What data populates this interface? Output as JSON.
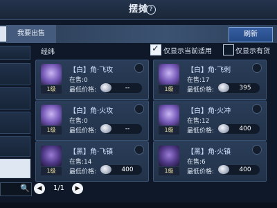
{
  "header": {
    "title": "摆摊",
    "help_icon_text": "?"
  },
  "tabs": [
    {
      "label": "我要出售"
    }
  ],
  "toolbar": {
    "refresh_label": "刷新"
  },
  "section": {
    "heading": "经纬"
  },
  "filters": {
    "current_use": {
      "label": "仅显示当前适用",
      "checked": true
    },
    "in_stock": {
      "label": "仅显示有货",
      "checked": false
    }
  },
  "items": [
    {
      "name": "【白】角·飞攻",
      "stock": "在售:0",
      "min_price_label": "最低价格:",
      "price": "--",
      "level": "1级",
      "quality": "white"
    },
    {
      "name": "【白】角·飞刺",
      "stock": "在售:17",
      "min_price_label": "最低价格:",
      "price": "395",
      "level": "1级",
      "quality": "white"
    },
    {
      "name": "【白】角·火攻",
      "stock": "在售:0",
      "min_price_label": "最低价格:",
      "price": "--",
      "level": "1级",
      "quality": "white"
    },
    {
      "name": "【白】角·火冲",
      "stock": "在售:12",
      "min_price_label": "最低价格:",
      "price": "400",
      "level": "1级",
      "quality": "white"
    },
    {
      "name": "【黑】角·飞镇",
      "stock": "在售:14",
      "min_price_label": "最低价格:",
      "price": "400",
      "level": "1级",
      "quality": "black"
    },
    {
      "name": "【黑】角·火镇",
      "stock": "在售:6",
      "min_price_label": "最低价格:",
      "price": "400",
      "level": "1级",
      "quality": "black"
    }
  ],
  "pagination": {
    "current": "1/1",
    "prev_icon": "◀",
    "next_icon": "▶"
  },
  "search": {
    "icon": "search-icon",
    "icon_glyph": "🔍"
  },
  "colors": {
    "accent": "#2f5ea5",
    "background": "#0e1828",
    "card": "#25374f"
  }
}
